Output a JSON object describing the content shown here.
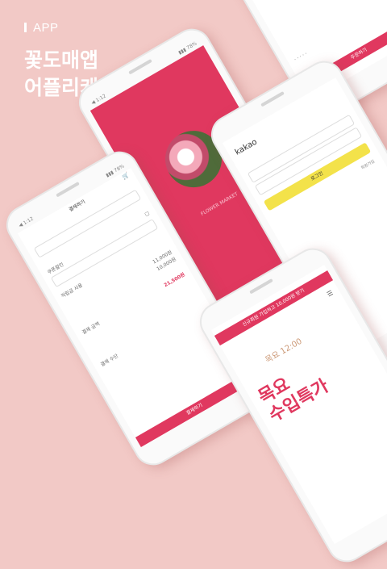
{
  "tag": "APP",
  "headline": {
    "line1": "꽃도매앱",
    "line2": "어플리케이션 제작"
  },
  "phones": {
    "top": {
      "button": "주문하기"
    },
    "splash": {
      "caption": "FLOWER MARKET"
    },
    "login": {
      "brand": "kakao",
      "login_button": "로그인",
      "signup": "회원가입"
    },
    "checkout": {
      "title": "결제하기",
      "coupon_label": "쿠폰할인",
      "point_label": "적립금 사용",
      "amount_1": "11,000원",
      "amount_2": "10,000원",
      "total_label": "결제 금액",
      "total_value": "21,500원",
      "pay_button": "결제하기",
      "method_label": "결제 수단"
    },
    "promo": {
      "banner": "신규회원 가입하고 10,000원 받기",
      "time_text": "목요 12:00",
      "line1": "목요",
      "line2": "수입특가"
    }
  },
  "colors": {
    "accent": "#e0385f",
    "background": "#f2c9c6",
    "kakao": "#f3e24a"
  }
}
